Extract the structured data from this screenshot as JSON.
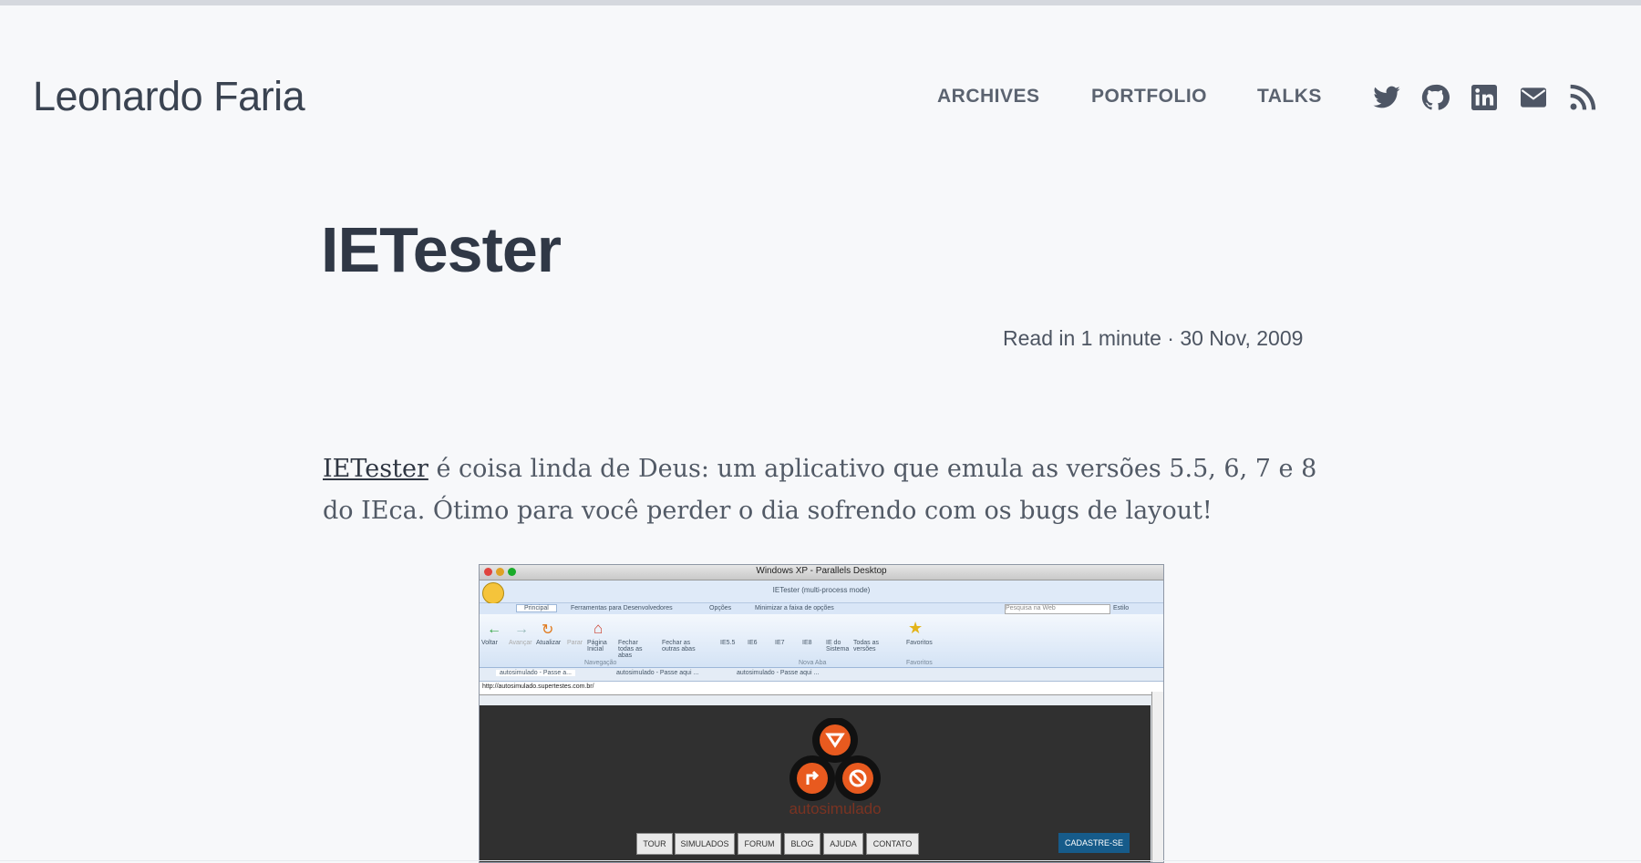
{
  "header": {
    "site_title": "Leonardo Faria",
    "nav": [
      {
        "label": "ARCHIVES"
      },
      {
        "label": "PORTFOLIO"
      },
      {
        "label": "TALKS"
      }
    ],
    "social_icons": [
      "twitter-icon",
      "github-icon",
      "linkedin-icon",
      "mail-icon",
      "rss-icon"
    ]
  },
  "post": {
    "title": "IETester",
    "meta": "Read in 1 minute · 30 Nov, 2009",
    "link_text": "IETester",
    "body_text": " é coisa linda de Deus: um aplicativo que emula as versões 5.5, 6, 7 e 8 do IEca. Ótimo para você perder o dia sofrendo com os bugs de layout!"
  },
  "screenshot": {
    "window_title": "Windows XP - Parallels Desktop",
    "app_title": "IETester (multi-process mode)",
    "tabs": [
      "Principal",
      "Ferramentas para Desenvolvedores",
      "Opções",
      "Minimizar a faixa de opções"
    ],
    "search_placeholder": "Pesquisa na Web",
    "estilo": "Estilo",
    "toolbar": [
      "Voltar",
      "Avançar",
      "Atualizar",
      "Parar",
      "Página Inicial",
      "Fechar todas as abas",
      "Fechar as outras abas",
      "IE5.5",
      "IE6",
      "IE7",
      "IE8",
      "IE do Sistema",
      "Todas as versões",
      "Favoritos"
    ],
    "groups": [
      "Navegação",
      "Nova Aba",
      "Favoritos"
    ],
    "browser_tabs": [
      "autosimulado - Passe a...",
      "autosimulado - Passe aqui ...",
      "autosimulado - Passe aqui ..."
    ],
    "address": "http://autosimulado.supertestes.com.br/",
    "site_name": "autosimulado",
    "site_menu": [
      "TOUR",
      "SIMULADOS",
      "FORUM",
      "BLOG",
      "AJUDA",
      "CONTATO"
    ],
    "cta": "CADASTRE-SE"
  },
  "colors": {
    "background": "#f7f8fa",
    "title": "#303846",
    "nav": "#5b6370",
    "body_text": "#525a66",
    "logo_orange": "#e85a1f"
  }
}
